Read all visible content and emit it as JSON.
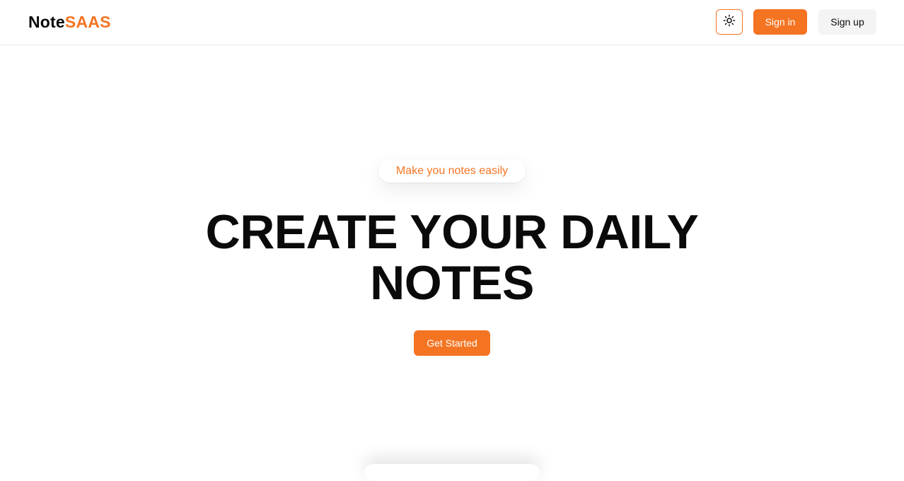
{
  "header": {
    "logo_main": "Note",
    "logo_accent": "SAAS",
    "theme_toggle_icon": "sun-icon",
    "signin_label": "Sign in",
    "signup_label": "Sign up"
  },
  "hero": {
    "tagline": "Make you notes easily",
    "title": "CREATE YOUR DAILY NOTES",
    "cta_label": "Get Started"
  },
  "colors": {
    "accent": "#f47422",
    "text": "#0a0a0a",
    "secondary_button": "#f4f4f5",
    "background": "#ffffff"
  }
}
